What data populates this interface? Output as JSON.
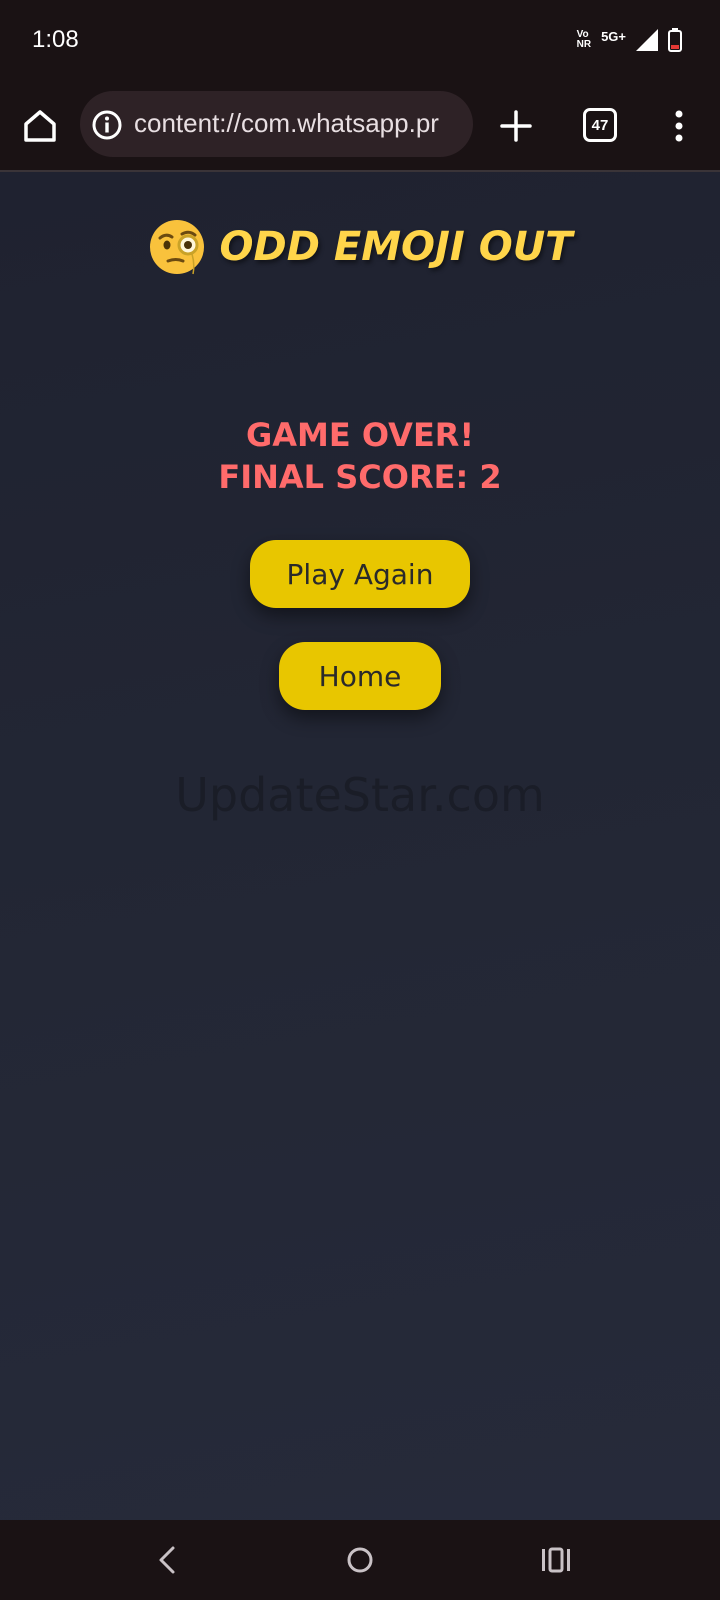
{
  "status_bar": {
    "time": "1:08",
    "volte_top": "Vo",
    "volte_bottom": "NR",
    "network": "5G+"
  },
  "browser": {
    "url": "content://com.whatsapp.pr",
    "tab_count": "47"
  },
  "game": {
    "title": "Odd Emoji Out",
    "result_line1": "Game Over!",
    "result_line2": "Final Score: 2",
    "play_again_label": "Play Again",
    "home_label": "Home",
    "watermark": "UpdateStar.com"
  },
  "colors": {
    "title": "#ffd54a",
    "result": "#ff6b6b",
    "button": "#e8c600",
    "background": "#232735"
  }
}
